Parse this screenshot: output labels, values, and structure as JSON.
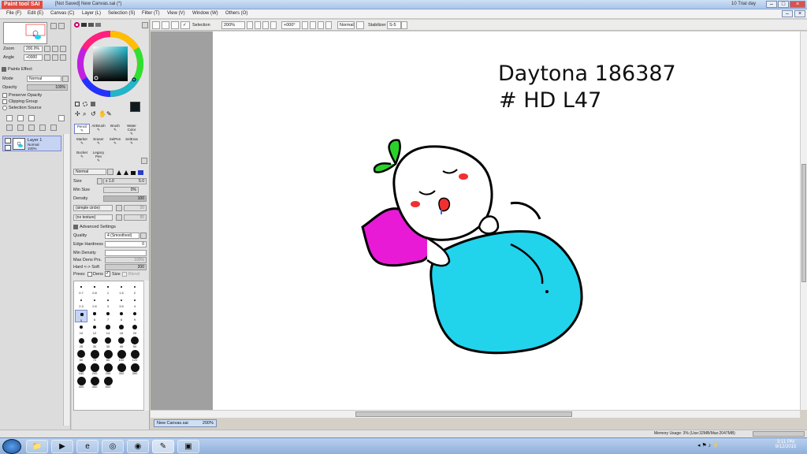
{
  "window": {
    "logo": "Paint tool SAI",
    "title": "[Not Saved] New Canvas.sai (*)",
    "trial": "10 Trial day"
  },
  "menu": [
    "File (F)",
    "Edit (E)",
    "Canvas (C)",
    "Layer (L)",
    "Selection (S)",
    "Filter (T)",
    "View (V)",
    "Window (W)",
    "Others (O)"
  ],
  "toolbar": {
    "selection_label": "Selection",
    "zoom": "200%",
    "angle": "+000°",
    "mode": "Normal",
    "stabilizer_label": "Stabilizer",
    "stabilizer_value": "S-5"
  },
  "navigator": {
    "zoom_label": "Zoom",
    "zoom_value": "200.0%",
    "angle_label": "Angle",
    "angle_value": "+0000"
  },
  "layer_panel": {
    "effects_label": "Paints Effect",
    "mode_label": "Mode",
    "mode_value": "Normal",
    "opacity_label": "Opacity",
    "opacity_value": "100%",
    "preserve_opacity": "Preserve Opacity",
    "clipping_group": "Clipping Group",
    "selection_source": "Selection Source",
    "layer_name": "Layer 1",
    "layer_mode": "Normal",
    "layer_opacity": "100%"
  },
  "tools": [
    {
      "name": "Pencil"
    },
    {
      "name": "AirBrush"
    },
    {
      "name": "Brush"
    },
    {
      "name": "Water Color"
    },
    {
      "name": "Marker"
    },
    {
      "name": "Eraser"
    },
    {
      "name": "SelPen"
    },
    {
      "name": "SelEras"
    },
    {
      "name": "Bucket"
    },
    {
      "name": "Legacy Pen"
    }
  ],
  "brush_settings": {
    "blend_mode": "Normal",
    "size_label": "Size",
    "size_mult": "x 1.0",
    "size_value": "5.0",
    "min_size_label": "Min Size",
    "min_size_value": "0%",
    "density_label": "Density",
    "density_value": "100",
    "shape": "(simple circle)",
    "shape_value": "20",
    "texture": "(no texture)",
    "texture_value": "95",
    "advanced_label": "Advanced Settings",
    "quality_label": "Quality",
    "quality_value": "4 (Smoothest)",
    "edge_label": "Edge Hardness",
    "edge_value": "0",
    "min_density_label": "Min Density",
    "max_dens_label": "Max Dens Prs.",
    "max_dens_value": "100%",
    "hard_soft_label": "Hard <-> Soft",
    "hard_soft_value": "200",
    "press_label": "Press:",
    "press_dens": "Dens",
    "press_size": "Size",
    "press_blend": "Blend"
  },
  "brush_sizes": [
    "0.7",
    "0.8",
    "1",
    "1.5",
    "2",
    "2.3",
    "2.6",
    "3",
    "3.5",
    "4",
    "5",
    "6",
    "7",
    "8",
    "9",
    "10",
    "12",
    "14",
    "16",
    "20",
    "25",
    "30",
    "35",
    "40",
    "50",
    "60",
    "70",
    "80",
    "100",
    "120",
    "160",
    "200",
    "250",
    "300",
    "350",
    "400",
    "450",
    "500"
  ],
  "canvas": {
    "note_line1": "Daytona 186387",
    "note_line2": "# HD L47"
  },
  "document_tab": {
    "name": "New Canvas.sai",
    "zoom": "200%"
  },
  "status": {
    "memory": "Memory Usage: 3% (Use:32MB/Max:2047MB)"
  },
  "clock": {
    "time": "3:11 PM",
    "date": "9/12/2015"
  },
  "colors": {
    "accent": "#e84a3a",
    "blanket": "#22d3ec",
    "pillow": "#e81ad6",
    "leaf": "#2bd12b",
    "cheeks": "#f03030"
  }
}
